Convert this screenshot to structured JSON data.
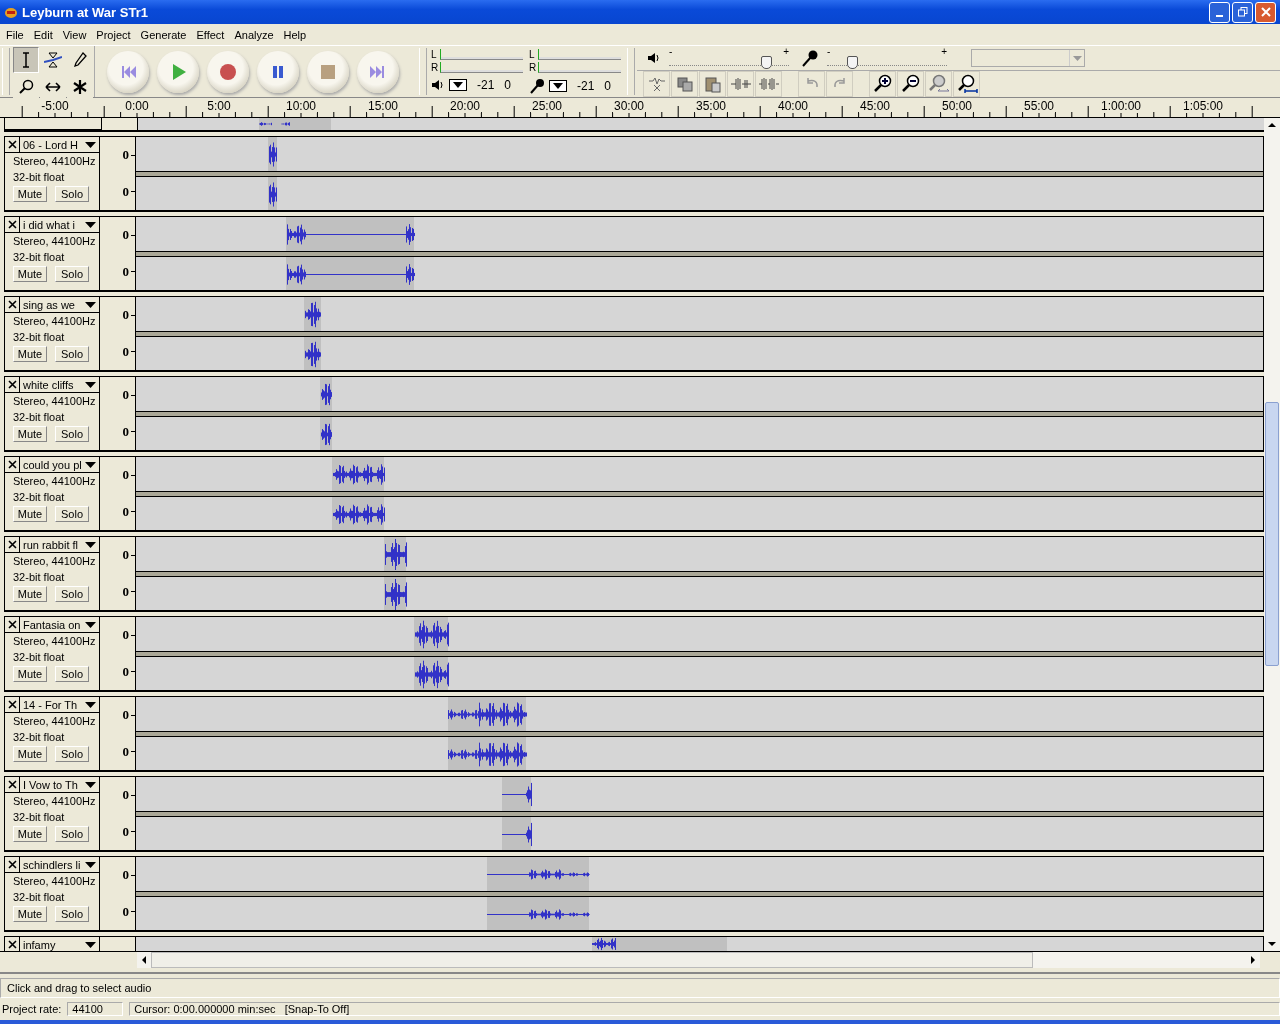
{
  "window": {
    "title": "Leyburn at War STr1"
  },
  "menu": [
    "File",
    "Edit",
    "View",
    "Project",
    "Generate",
    "Effect",
    "Analyze",
    "Help"
  ],
  "tools": [
    {
      "kind": "select",
      "selected": true
    },
    {
      "kind": "envelope",
      "selected": false
    },
    {
      "kind": "draw",
      "selected": false
    },
    {
      "kind": "zoom",
      "selected": false
    },
    {
      "kind": "timeshift",
      "selected": false
    },
    {
      "kind": "multi",
      "selected": false
    }
  ],
  "transport": [
    {
      "kind": "start"
    },
    {
      "kind": "play"
    },
    {
      "kind": "record"
    },
    {
      "kind": "pause"
    },
    {
      "kind": "stop"
    },
    {
      "kind": "end"
    }
  ],
  "meters": [
    {
      "kind": "speaker",
      "channels": [
        "L",
        "R"
      ],
      "low": "-21",
      "high": "0"
    },
    {
      "kind": "mic",
      "channels": [
        "L",
        "R"
      ],
      "low": "-21",
      "high": "0"
    }
  ],
  "mixer": [
    {
      "kind": "speaker",
      "minus": "-",
      "plus": "+",
      "level": 0.8
    },
    {
      "kind": "mic",
      "minus": "-",
      "plus": "+",
      "level": 0.2
    }
  ],
  "ruler": [
    "-5:00",
    "0:00",
    "5:00",
    "10:00",
    "15:00",
    "20:00",
    "25:00",
    "30:00",
    "35:00",
    "40:00",
    "45:00",
    "50:00",
    "55:00",
    "1:00:00",
    "1:05:00"
  ],
  "tracks": [
    {
      "name": "06 - Lord H",
      "format": "Stereo, 44100Hz",
      "sample": "32-bit float",
      "mute": "Mute",
      "solo": "Solo",
      "scale": [
        "0",
        "0"
      ]
    },
    {
      "name": "i did what i",
      "format": "Stereo, 44100Hz",
      "sample": "32-bit float",
      "mute": "Mute",
      "solo": "Solo",
      "scale": [
        "0",
        "0"
      ]
    },
    {
      "name": "sing as we",
      "format": "Stereo, 44100Hz",
      "sample": "32-bit float",
      "mute": "Mute",
      "solo": "Solo",
      "scale": [
        "0",
        "0"
      ]
    },
    {
      "name": "white cliffs",
      "format": "Stereo, 44100Hz",
      "sample": "32-bit float",
      "mute": "Mute",
      "solo": "Solo",
      "scale": [
        "0",
        "0"
      ]
    },
    {
      "name": "could you pl",
      "format": "Stereo, 44100Hz",
      "sample": "32-bit float",
      "mute": "Mute",
      "solo": "Solo",
      "scale": [
        "0",
        "0"
      ]
    },
    {
      "name": "run rabbit fl",
      "format": "Stereo, 44100Hz",
      "sample": "32-bit float",
      "mute": "Mute",
      "solo": "Solo",
      "scale": [
        "0",
        "0"
      ]
    },
    {
      "name": "Fantasia on",
      "format": "Stereo, 44100Hz",
      "sample": "32-bit float",
      "mute": "Mute",
      "solo": "Solo",
      "scale": [
        "0",
        "0"
      ]
    },
    {
      "name": "14 - For Th",
      "format": "Stereo, 44100Hz",
      "sample": "32-bit float",
      "mute": "Mute",
      "solo": "Solo",
      "scale": [
        "0",
        "0"
      ]
    },
    {
      "name": "I Vow to Th",
      "format": "Stereo, 44100Hz",
      "sample": "32-bit float",
      "mute": "Mute",
      "solo": "Solo",
      "scale": [
        "0",
        "0"
      ]
    },
    {
      "name": "schindlers li",
      "format": "Stereo, 44100Hz",
      "sample": "32-bit float",
      "mute": "Mute",
      "solo": "Solo",
      "scale": [
        "0",
        "0"
      ]
    },
    {
      "name": "infamy"
    }
  ],
  "status": {
    "message": "Click and drag to select audio",
    "rate_label": "Project rate:",
    "rate": "44100",
    "cursor": "Cursor: 0:00.000000 min:sec   [Snap-To Off]"
  }
}
